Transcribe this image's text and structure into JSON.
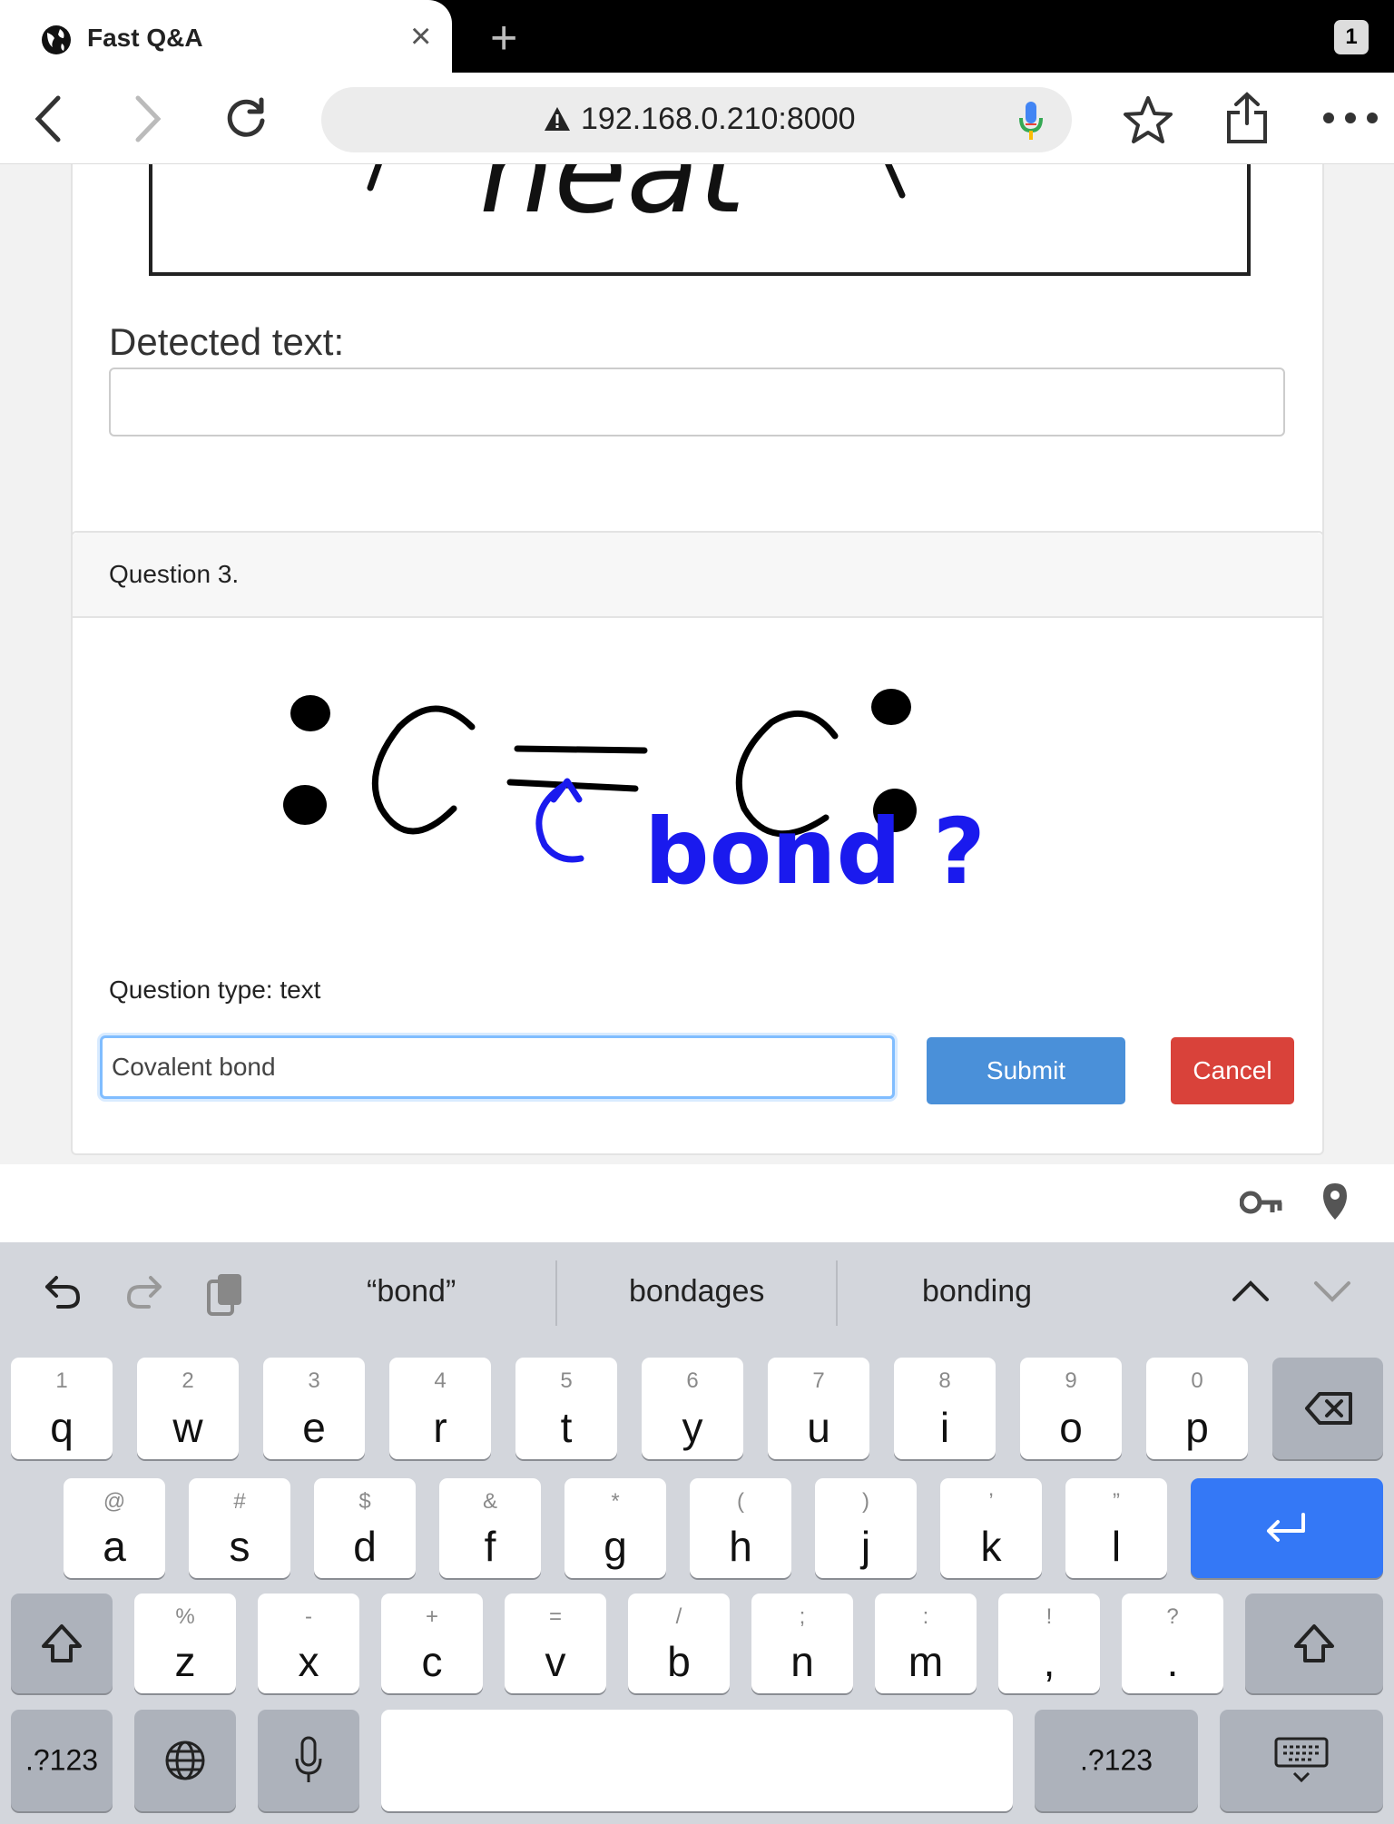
{
  "browser": {
    "tab_title": "Fast Q&A",
    "tab_count": "1",
    "url": "192.168.0.210:8000"
  },
  "previous_card": {
    "drawing_text": "heat",
    "detected_label": "Detected text:",
    "detected_value": ""
  },
  "question": {
    "title": "Question 3.",
    "drawing_text": "bond ?",
    "type_label": "Question type: text",
    "answer_value": "Covalent bond",
    "submit_label": "Submit",
    "cancel_label": "Cancel"
  },
  "keyboard": {
    "suggestions": [
      "“bond”",
      "bondages",
      "bonding"
    ],
    "row1": [
      {
        "main": "q",
        "sec": "1"
      },
      {
        "main": "w",
        "sec": "2"
      },
      {
        "main": "e",
        "sec": "3"
      },
      {
        "main": "r",
        "sec": "4"
      },
      {
        "main": "t",
        "sec": "5"
      },
      {
        "main": "y",
        "sec": "6"
      },
      {
        "main": "u",
        "sec": "7"
      },
      {
        "main": "i",
        "sec": "8"
      },
      {
        "main": "o",
        "sec": "9"
      },
      {
        "main": "p",
        "sec": "0"
      }
    ],
    "row2": [
      {
        "main": "a",
        "sec": "@"
      },
      {
        "main": "s",
        "sec": "#"
      },
      {
        "main": "d",
        "sec": "$"
      },
      {
        "main": "f",
        "sec": "&"
      },
      {
        "main": "g",
        "sec": "*"
      },
      {
        "main": "h",
        "sec": "("
      },
      {
        "main": "j",
        "sec": ")"
      },
      {
        "main": "k",
        "sec": "’"
      },
      {
        "main": "l",
        "sec": "”"
      }
    ],
    "row3": [
      {
        "main": "z",
        "sec": "%"
      },
      {
        "main": "x",
        "sec": "-"
      },
      {
        "main": "c",
        "sec": "+"
      },
      {
        "main": "v",
        "sec": "="
      },
      {
        "main": "b",
        "sec": "/"
      },
      {
        "main": "n",
        "sec": ";"
      },
      {
        "main": "m",
        "sec": ":"
      },
      {
        "main": ",",
        "sec": "!"
      },
      {
        "main": ".",
        "sec": "?"
      }
    ],
    "numbers_label": ".?123",
    "numbers_label_right": ".?123"
  }
}
